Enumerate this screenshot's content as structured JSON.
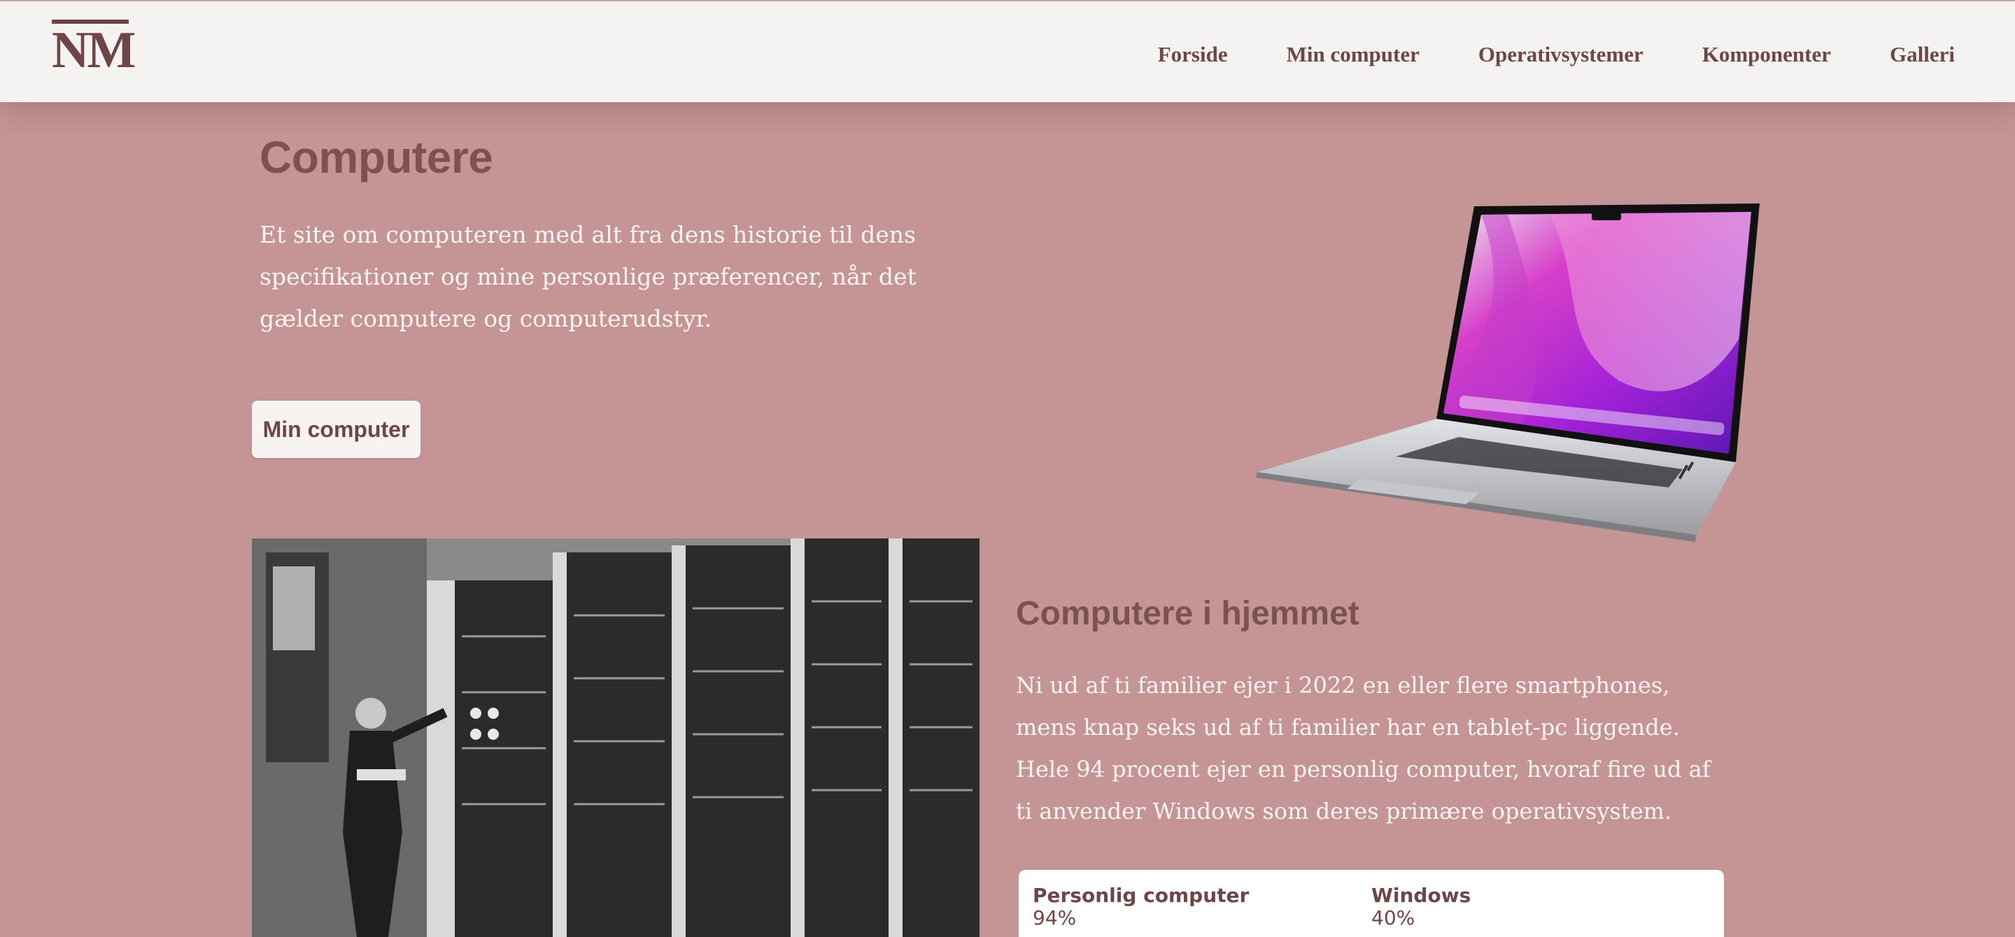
{
  "header": {
    "logo": "NM",
    "nav": [
      "Forside",
      "Min computer",
      "Operativsystemer",
      "Komponenter",
      "Galleri"
    ]
  },
  "hero": {
    "title": "Computere",
    "text": "Et site om computeren med alt fra dens historie til dens specifikationer og mine personlige præferencer, når det gælder computere og computerudstyr.",
    "button_label": "Min computer"
  },
  "section": {
    "title": "Computere i hjemmet",
    "text": "Ni ud af ti familier ejer i 2022 en eller flere smartphones, mens knap seks ud af ti familier har en tablet-pc liggende. Hele 94 procent ejer en personlig computer, hvoraf fire ud af ti anvender Windows som deres primære operativsystem.",
    "stats": [
      {
        "label": "Personlig computer",
        "value": "94%"
      },
      {
        "label": "Windows",
        "value": "40%"
      }
    ]
  },
  "colors": {
    "background": "#c59596",
    "header": "#f5f3f1",
    "accent": "#6e4647",
    "title": "#7c5152"
  },
  "images": {
    "hero": "laptop-image",
    "history": "vintage-computer-photo"
  }
}
